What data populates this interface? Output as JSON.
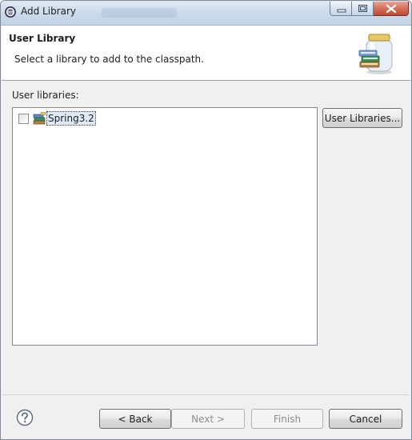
{
  "window": {
    "title": "Add Library",
    "app_icon": "eclipse-icon",
    "controls": [
      "minimize-icon",
      "maximize-icon",
      "close-icon"
    ]
  },
  "banner": {
    "title": "User Library",
    "description": "Select a library to add to the classpath.",
    "icon": "library-jar-icon"
  },
  "libraries": {
    "label": "User libraries:",
    "items": [
      {
        "name": "Spring3.2",
        "checked": false,
        "icon": "library-icon"
      }
    ],
    "user_libraries_button": "User Libraries..."
  },
  "footer": {
    "help_icon": "help-icon",
    "back_label": "< Back",
    "next_label": "Next >",
    "finish_label": "Finish",
    "cancel_label": "Cancel",
    "next_enabled": false,
    "finish_enabled": false
  },
  "colors": {
    "titlebar": "#c9d9ea",
    "close_button": "#c04a32",
    "dialog_background": "#f0f0f0",
    "selection": "#dfeaf6"
  }
}
